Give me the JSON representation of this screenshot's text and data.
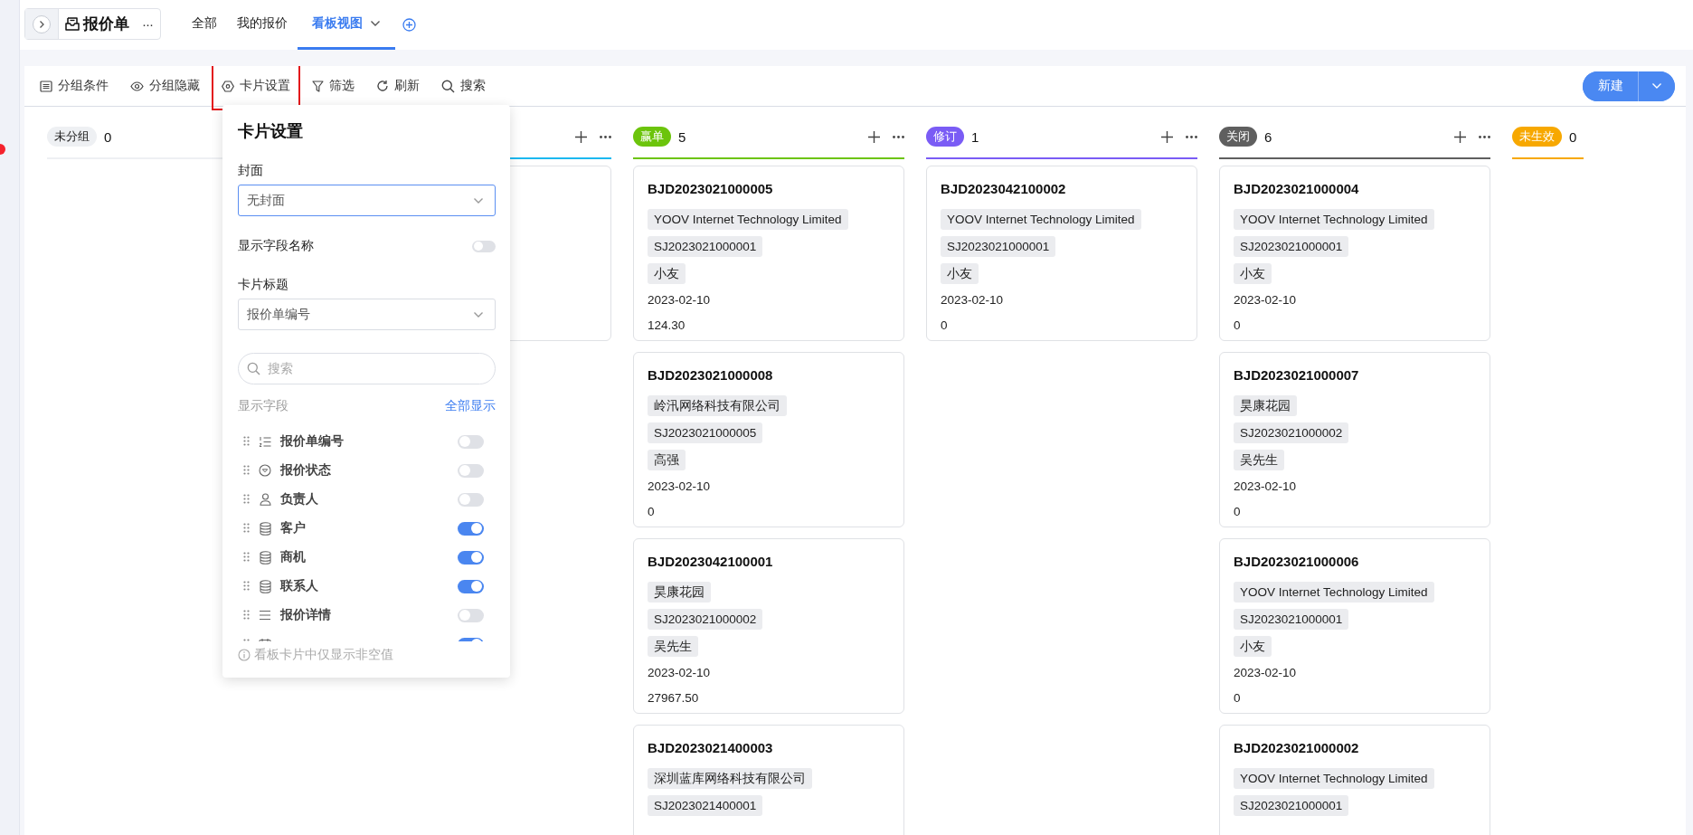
{
  "sidebar_strip": {
    "notification_dot": true
  },
  "app": {
    "title": "报价单",
    "more": "···"
  },
  "view_tabs": [
    {
      "label": "全部",
      "selected": false
    },
    {
      "label": "我的报价",
      "selected": false
    },
    {
      "label": "看板视图",
      "selected": true
    }
  ],
  "toolbar": {
    "actions": [
      {
        "label": "分组条件",
        "kind": "group",
        "highlighted": false
      },
      {
        "label": "分组隐藏",
        "kind": "hide",
        "highlighted": false
      },
      {
        "label": "卡片设置",
        "kind": "card",
        "highlighted": true
      },
      {
        "label": "筛选",
        "kind": "filter",
        "highlighted": false
      },
      {
        "label": "刷新",
        "kind": "refresh",
        "highlighted": false
      },
      {
        "label": "搜索",
        "kind": "search",
        "highlighted": false
      }
    ],
    "new_button": "新建"
  },
  "columns": [
    {
      "label": "未分组",
      "count": "0",
      "color": "#eef0f3"
    },
    {
      "color": "#1cb8f0",
      "actions": true,
      "cards": [
        {
          "kind": "covered"
        }
      ]
    },
    {
      "label": "赢单",
      "count": "5",
      "color": "#6cc40c",
      "actions": true,
      "cards": [
        {
          "kind": "record",
          "title": "BJD2023021000005",
          "tags": [
            "YOOV Internet Technology Limited",
            "SJ2023021000001",
            "小友"
          ],
          "date": "2023-02-10",
          "amount": "124.30"
        },
        {
          "kind": "record",
          "title": "BJD2023021000008",
          "tags": [
            "岭汛网络科技有限公司",
            "SJ2023021000005",
            "高强"
          ],
          "date": "2023-02-10",
          "amount": "0"
        },
        {
          "kind": "record",
          "title": "BJD2023042100001",
          "tags": [
            "昊康花园",
            "SJ2023021000002",
            "吴先生"
          ],
          "date": "2023-02-10",
          "amount": "27967.50"
        },
        {
          "kind": "record",
          "title": "BJD2023021400003",
          "tags": [
            "深圳蓝库网络科技有限公司",
            "SJ2023021400001"
          ]
        }
      ]
    },
    {
      "label": "修订",
      "count": "1",
      "color": "#7a5cf5",
      "actions": true,
      "cards": [
        {
          "kind": "record",
          "title": "BJD2023042100002",
          "tags": [
            "YOOV Internet Technology Limited",
            "SJ2023021000001",
            "小友"
          ],
          "date": "2023-02-10",
          "amount": "0"
        }
      ]
    },
    {
      "label": "关闭",
      "count": "6",
      "color": "#5f5f5f",
      "actions": true,
      "cards": [
        {
          "kind": "record",
          "title": "BJD2023021000004",
          "tags": [
            "YOOV Internet Technology Limited",
            "SJ2023021000001",
            "小友"
          ],
          "date": "2023-02-10",
          "amount": "0"
        },
        {
          "kind": "record",
          "title": "BJD2023021000007",
          "tags": [
            "昊康花园",
            "SJ2023021000002",
            "吴先生"
          ],
          "date": "2023-02-10",
          "amount": "0"
        },
        {
          "kind": "record",
          "title": "BJD2023021000006",
          "tags": [
            "YOOV Internet Technology Limited",
            "SJ2023021000001",
            "小友"
          ],
          "date": "2023-02-10",
          "amount": "0"
        },
        {
          "kind": "record",
          "title": "BJD2023021000002",
          "tags": [
            "YOOV Internet Technology Limited",
            "SJ2023021000001"
          ]
        }
      ]
    },
    {
      "label": "未生效",
      "count": "0",
      "color": "#f7a800",
      "actions": false
    }
  ],
  "card_settings": {
    "title": "卡片设置",
    "cover_label": "封面",
    "cover_value": "无封面",
    "show_field_names_label": "显示字段名称",
    "show_field_names": false,
    "card_title_label": "卡片标题",
    "card_title_value": "报价单编号",
    "search_placeholder": "搜索",
    "fields_label": "显示字段",
    "show_all": "全部显示",
    "fields": [
      {
        "label": "报价单编号",
        "kind": "number",
        "on": false
      },
      {
        "label": "报价状态",
        "kind": "status",
        "on": false
      },
      {
        "label": "负责人",
        "kind": "user",
        "on": false
      },
      {
        "label": "客户",
        "kind": "relation",
        "on": true
      },
      {
        "label": "商机",
        "kind": "relation",
        "on": true
      },
      {
        "label": "联系人",
        "kind": "relation",
        "on": true
      },
      {
        "label": "报价详情",
        "kind": "text",
        "on": false
      },
      {
        "kind": "date",
        "on": true
      }
    ],
    "footer": "看板卡片中仅显示非空值"
  }
}
